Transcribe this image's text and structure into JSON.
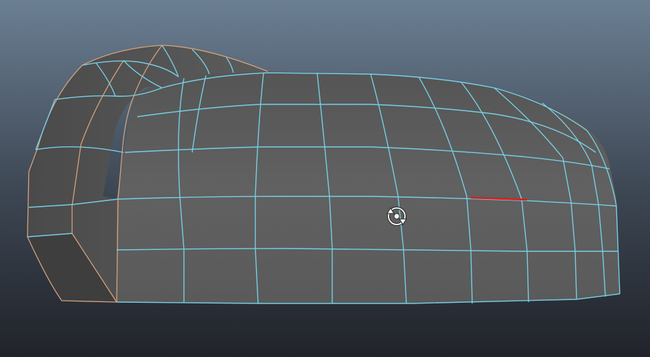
{
  "viewport": {
    "background_top": "#6b7f93",
    "background_mid": "#3c4552",
    "background_bottom": "#202329"
  },
  "mesh": {
    "surface_color": "#5c5c5c",
    "wire_color": "#76d0e6",
    "border_edge_color": "#d9a27a",
    "selected_edge_color": "#e01a1a"
  },
  "cursor": {
    "icon": "rotate-tumble-icon"
  }
}
